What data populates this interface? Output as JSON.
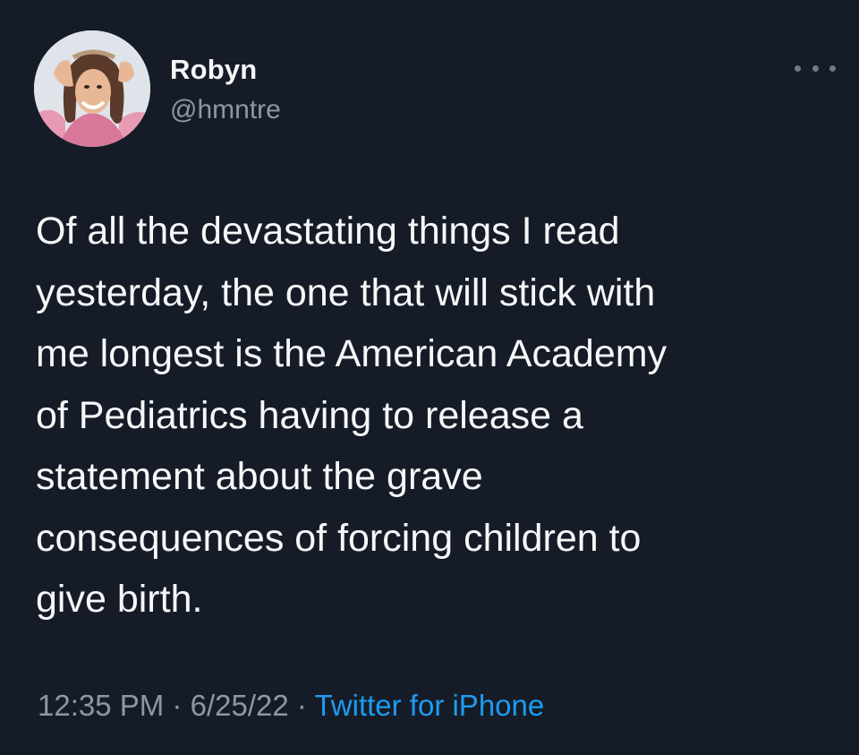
{
  "tweet": {
    "author": {
      "display_name": "Robyn",
      "handle": "@hmntre",
      "avatar_icon": "profile-photo"
    },
    "more_icon": "more-horizontal-icon",
    "text": "Of all the devastating things I read\nyesterday, the one that will stick with\nme longest is the American Academy\nof Pediatrics having to release a\nstatement about the grave\nconsequences of forcing children to\ngive birth.",
    "time": "12:35 PM",
    "separator": "·",
    "date": "6/25/22",
    "source": "Twitter for iPhone"
  },
  "colors": {
    "background": "#161c27",
    "text": "#f5f7f9",
    "secondary": "#8b98a5",
    "link": "#1d9bf0"
  }
}
